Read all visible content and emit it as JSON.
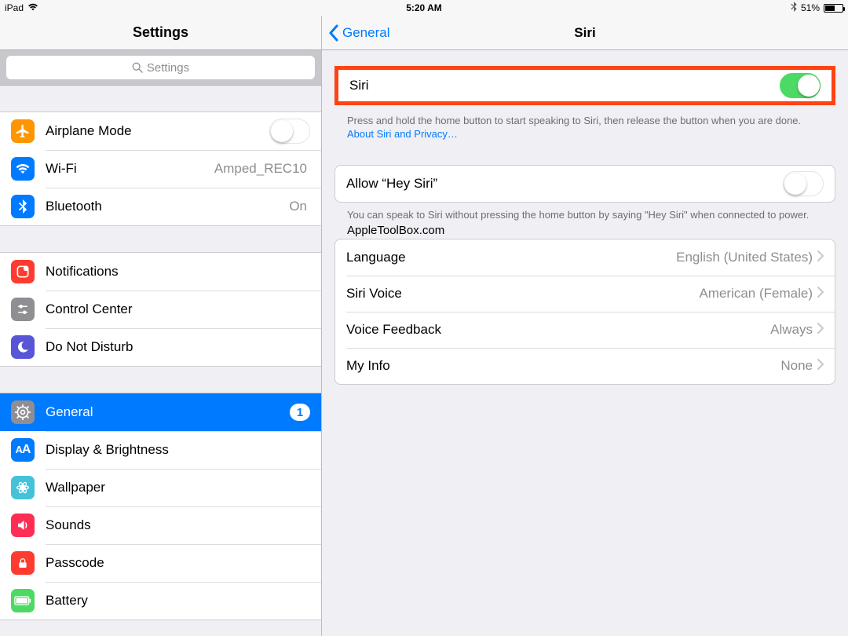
{
  "statusbar": {
    "device": "iPad",
    "time": "5:20 AM",
    "battery_pct": "51%",
    "battery_fill_pct": 51
  },
  "sidebar": {
    "title": "Settings",
    "search_placeholder": "Settings",
    "groups": [
      {
        "rows": [
          {
            "id": "airplane",
            "icon": "airplane",
            "bg": "#ff9500",
            "label": "Airplane Mode",
            "toggle": false
          },
          {
            "id": "wifi",
            "icon": "wifi",
            "bg": "#007aff",
            "label": "Wi-Fi",
            "value": "Amped_REC10"
          },
          {
            "id": "bluetooth",
            "icon": "bt",
            "bg": "#007aff",
            "label": "Bluetooth",
            "value": "On"
          }
        ]
      },
      {
        "rows": [
          {
            "id": "notifications",
            "icon": "notify",
            "bg": "#ff3b30",
            "label": "Notifications"
          },
          {
            "id": "controlcenter",
            "icon": "cc",
            "bg": "#8e8e93",
            "label": "Control Center"
          },
          {
            "id": "dnd",
            "icon": "moon",
            "bg": "#5856d6",
            "label": "Do Not Disturb"
          }
        ]
      },
      {
        "rows": [
          {
            "id": "general",
            "icon": "gear",
            "bg": "#8e8e93",
            "label": "General",
            "selected": true,
            "badge": "1"
          },
          {
            "id": "display",
            "icon": "aa",
            "bg": "#007aff",
            "label": "Display & Brightness"
          },
          {
            "id": "wallpaper",
            "icon": "flower",
            "bg": "#45c2da",
            "label": "Wallpaper"
          },
          {
            "id": "sounds",
            "icon": "speaker",
            "bg": "#ff2d55",
            "label": "Sounds"
          },
          {
            "id": "passcode",
            "icon": "lock",
            "bg": "#ff3b30",
            "label": "Passcode"
          },
          {
            "id": "battery",
            "icon": "battery",
            "bg": "#4cd964",
            "label": "Battery"
          }
        ]
      }
    ]
  },
  "detail": {
    "back_label": "General",
    "title": "Siri",
    "main_toggle": {
      "label": "Siri",
      "on": true
    },
    "main_footer_pre": "Press and hold the home button to start speaking to Siri, then release the button when you are done. ",
    "main_footer_link": "About Siri and Privacy…",
    "hey_siri": {
      "label": "Allow “Hey Siri”",
      "on": false
    },
    "hey_siri_footer": "You can speak to Siri without pressing the home button by saying \"Hey Siri\" when connected to power.",
    "watermark": "AppleToolBox.com",
    "settings_rows": [
      {
        "id": "language",
        "label": "Language",
        "value": "English (United States)"
      },
      {
        "id": "voice",
        "label": "Siri Voice",
        "value": "American (Female)"
      },
      {
        "id": "feedback",
        "label": "Voice Feedback",
        "value": "Always"
      },
      {
        "id": "myinfo",
        "label": "My Info",
        "value": "None"
      }
    ]
  }
}
